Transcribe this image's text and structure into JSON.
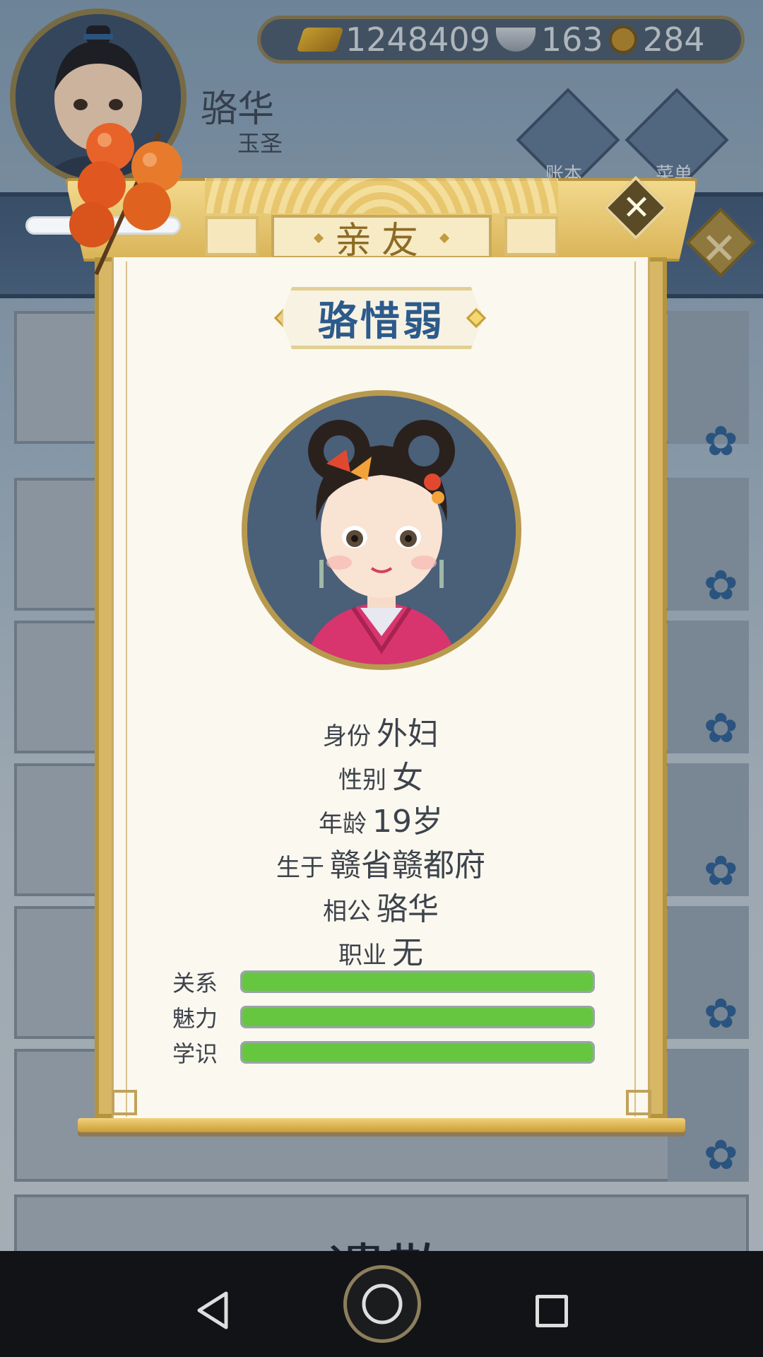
{
  "player": {
    "name": "骆华",
    "title": "玉圣"
  },
  "currency": {
    "gold": "1248409",
    "silver": "163",
    "coin": "284"
  },
  "top_buttons": [
    {
      "label": "账本",
      "icon": "ledger-icon"
    },
    {
      "label": "菜单",
      "icon": "more-icon"
    }
  ],
  "background": {
    "bottom_word": "遣散"
  },
  "dialog": {
    "title": "亲友",
    "close_glyph": "✕",
    "person_name": "骆惜弱",
    "fields": [
      {
        "label": "身份",
        "value": "外妇"
      },
      {
        "label": "性别",
        "value": "女"
      },
      {
        "label": "年龄",
        "value": "19岁"
      },
      {
        "label": "生于",
        "value": "赣省赣都府"
      },
      {
        "label": "相公",
        "value": "骆华"
      },
      {
        "label": "职业",
        "value": "无"
      }
    ],
    "stats": [
      {
        "label": "关系",
        "fill": 1.0
      },
      {
        "label": "魅力",
        "fill": 1.0
      },
      {
        "label": "学识",
        "fill": 1.0
      }
    ]
  },
  "navbar": {
    "buttons": [
      "back",
      "home",
      "recent-apps"
    ]
  },
  "colors": {
    "name_blue": "#2c5a8c",
    "bar_green": "#66c640",
    "gold_frame": "#d7b766"
  }
}
